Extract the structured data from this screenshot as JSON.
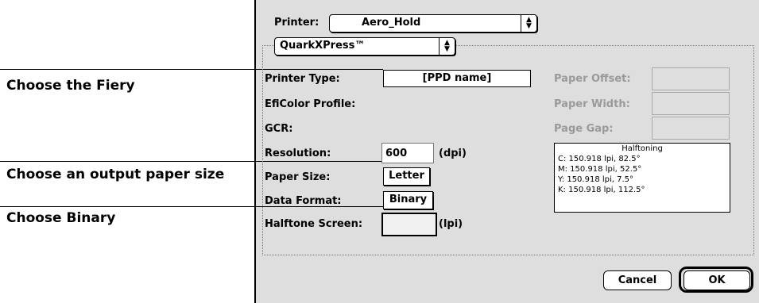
{
  "callouts": {
    "fiery": "Choose the Fiery",
    "paper_size": "Choose an output paper size",
    "binary": "Choose Binary"
  },
  "dialog": {
    "printer_label": "Printer:",
    "printer_value": "Aero_Hold",
    "app_popup_value": "QuarkXPress™",
    "printer_type_label": "Printer Type:",
    "printer_type_value": "[PPD name]",
    "eficolor_label": "EfiColor Profile:",
    "gcr_label": "GCR:",
    "resolution_label": "Resolution:",
    "resolution_value": "600",
    "resolution_unit": "(dpi)",
    "paper_size_label": "Paper Size:",
    "paper_size_value": "Letter",
    "data_format_label": "Data Format:",
    "data_format_value": "Binary",
    "halftone_screen_label": "Halftone Screen:",
    "halftone_screen_unit": "(lpi)",
    "paper_offset_label": "Paper Offset:",
    "paper_width_label": "Paper Width:",
    "page_gap_label": "Page Gap:",
    "halftoning": {
      "title": "Halftoning",
      "rows": [
        "C: 150.918 lpi, 82.5°",
        "M: 150.918 lpi, 52.5°",
        "Y: 150.918 lpi, 7.5°",
        "K: 150.918 lpi, 112.5°"
      ]
    },
    "cancel_label": "Cancel",
    "ok_label": "OK"
  }
}
